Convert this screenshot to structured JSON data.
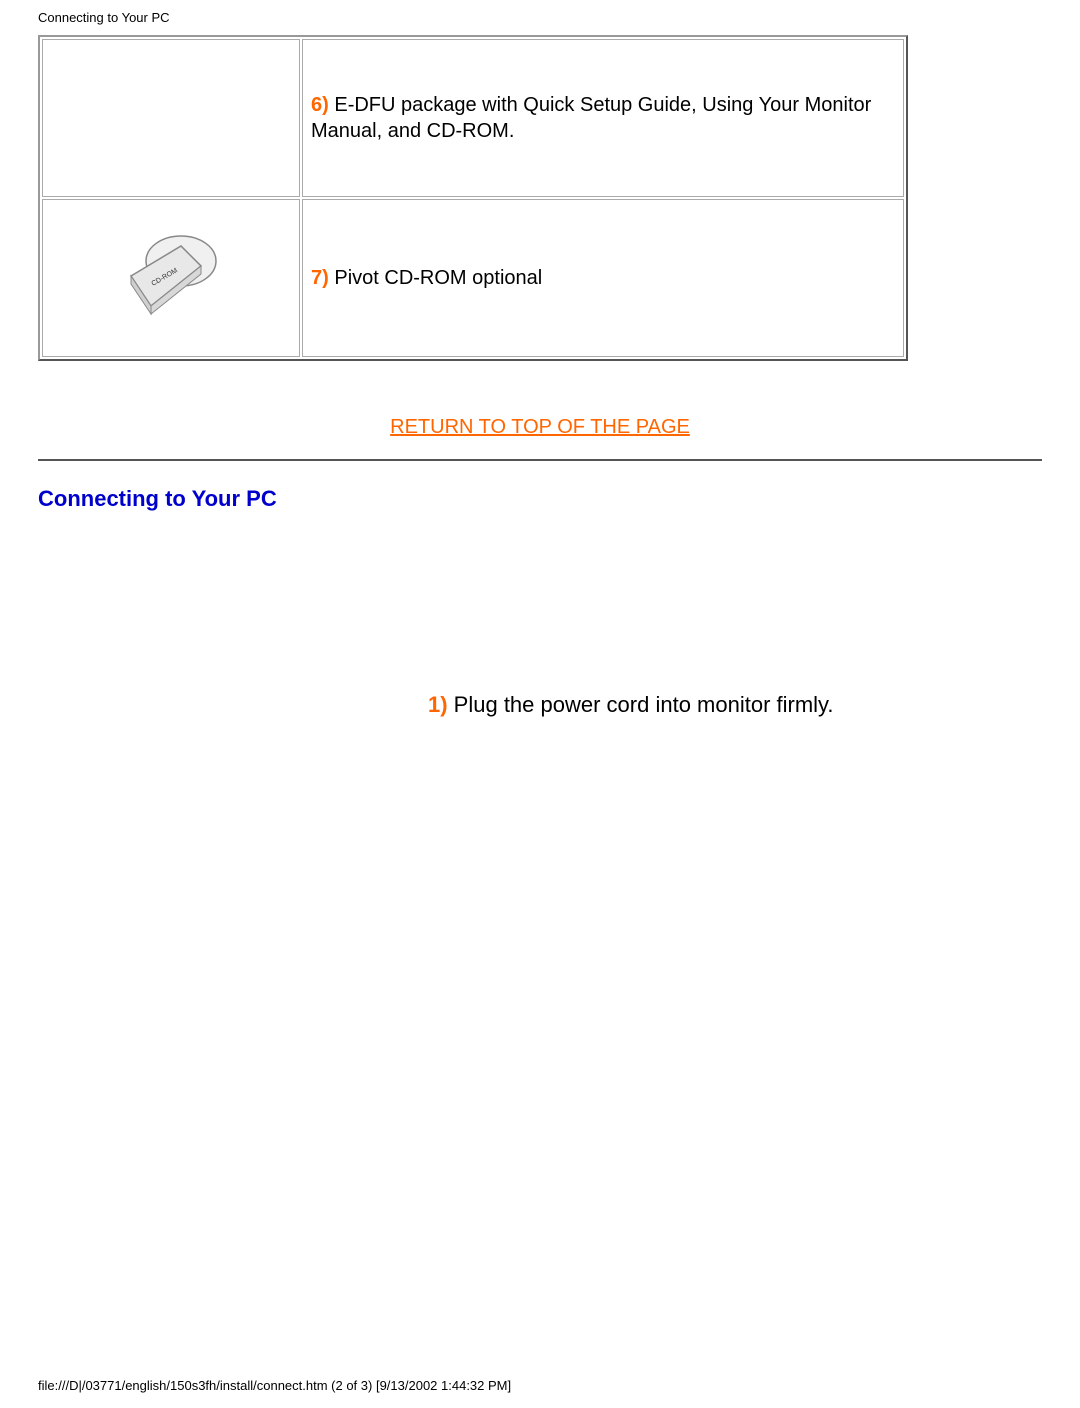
{
  "header": {
    "title": "Connecting to Your PC"
  },
  "table": {
    "row6": {
      "num": "6)",
      "text": " E-DFU package with Quick Setup Guide, Using Your Monitor Manual, and CD-ROM."
    },
    "row7": {
      "num": "7)",
      "text": " Pivot CD-ROM optional"
    }
  },
  "return_link": "RETURN TO TOP OF THE PAGE",
  "section_heading": "Connecting to Your PC",
  "instruction": {
    "num": "1)",
    "text": " Plug the power cord into monitor firmly."
  },
  "footer": "file:///D|/03771/english/150s3fh/install/connect.htm (2 of 3) [9/13/2002 1:44:32 PM]"
}
